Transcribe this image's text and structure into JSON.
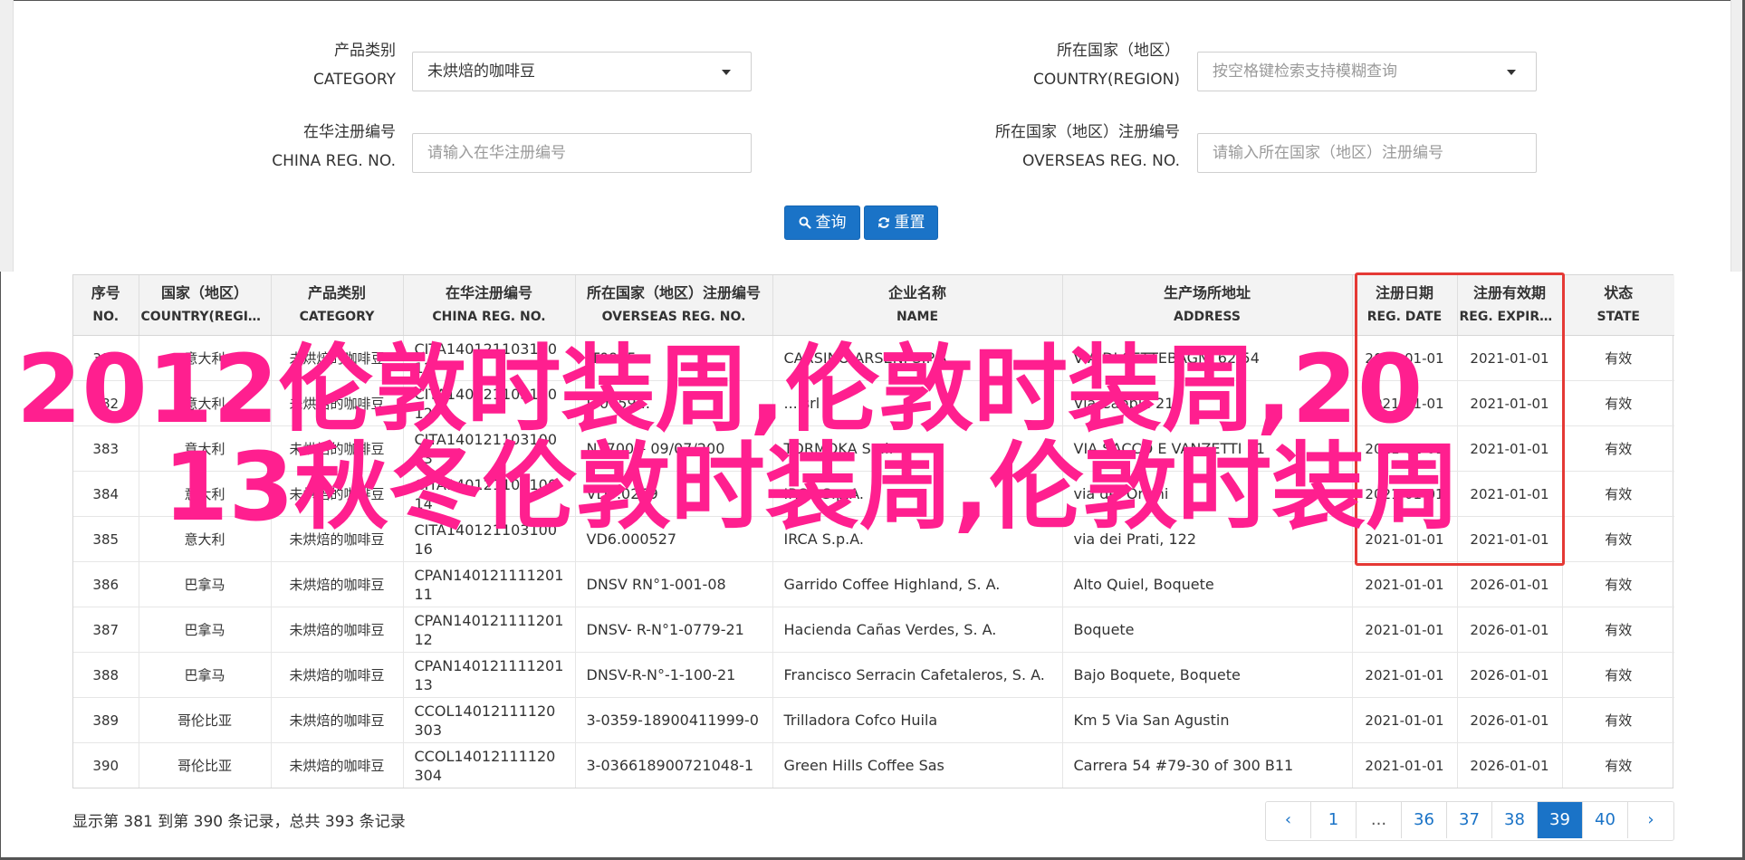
{
  "filters": {
    "category": {
      "label_cn": "产品类别",
      "label_en": "CATEGORY",
      "value": "未烘焙的咖啡豆"
    },
    "country": {
      "label_cn": "所在国家（地区）",
      "label_en": "COUNTRY(REGION)",
      "placeholder": "按空格键检索支持模糊查询"
    },
    "china_reg": {
      "label_cn": "在华注册编号",
      "label_en": "CHINA REG. NO.",
      "placeholder": "请输入在华注册编号"
    },
    "overseas_reg": {
      "label_cn": "所在国家（地区）注册编号",
      "label_en": "OVERSEAS REG. NO.",
      "placeholder": "请输入所在国家（地区）注册编号"
    }
  },
  "buttons": {
    "query": "查询",
    "reset": "重置"
  },
  "table": {
    "headers": [
      {
        "cn": "序号",
        "en": "NO."
      },
      {
        "cn": "国家（地区）",
        "en": "COUNTRY(REGIO..."
      },
      {
        "cn": "产品类别",
        "en": "CATEGORY"
      },
      {
        "cn": "在华注册编号",
        "en": "CHINA REG. NO."
      },
      {
        "cn": "所在国家（地区）注册编号",
        "en": "OVERSEAS REG. NO."
      },
      {
        "cn": "企业名称",
        "en": "NAME"
      },
      {
        "cn": "生产场所地址",
        "en": "ADDRESS"
      },
      {
        "cn": "注册日期",
        "en": "REG. DATE"
      },
      {
        "cn": "注册有效期",
        "en": "REG. EXPIRE ..."
      },
      {
        "cn": "状态",
        "en": "STATE"
      }
    ],
    "rows": [
      [
        "381",
        "意大利",
        "未烘焙的咖啡豆",
        "CITA14012110310011",
        "IT0905...",
        "CARSINO ARSENI S.P.A.",
        "VIA DI SETTEBAGNI 62/54",
        "2021-01-01",
        "2021-01-01",
        "有效"
      ],
      [
        "382",
        "意大利",
        "未烘焙的咖啡豆",
        "CITA14012110310012",
        "IT0059...",
        "... srl",
        "Via Cabbia 21",
        "2021-01-01",
        "2021-01-01",
        "有效"
      ],
      [
        "383",
        "意大利",
        "未烘焙的咖啡豆",
        "CITA14012110310013",
        "N. 700 – 09/07/200",
        "TORMOKA S.r.l.",
        "VIA SACCO E VANZETTI 11",
        "2021-01-01",
        "2021-01-01",
        "有效"
      ],
      [
        "384",
        "意大利",
        "未烘焙的咖啡豆",
        "CITA14012110310014",
        "VD6.0269",
        "IRCA S.p.A.",
        "via dei Orsini",
        "2021-01-01",
        "2021-01-01",
        "有效"
      ],
      [
        "385",
        "意大利",
        "未烘焙的咖啡豆",
        "CITA14012110310016",
        "VD6.000527",
        "IRCA S.p.A.",
        "via dei Prati, 122",
        "2021-01-01",
        "2021-01-01",
        "有效"
      ],
      [
        "386",
        "巴拿马",
        "未烘焙的咖啡豆",
        "CPAN14012111120111",
        "DNSV RN°1-001-08",
        "Garrido Coffee Highland, S. A.",
        "Alto Quiel, Boquete",
        "2021-01-01",
        "2026-01-01",
        "有效"
      ],
      [
        "387",
        "巴拿马",
        "未烘焙的咖啡豆",
        "CPAN14012111120112",
        "DNSV- R-N°1-0779-21",
        "Hacienda Cañas Verdes, S. A.",
        "Boquete",
        "2021-01-01",
        "2026-01-01",
        "有效"
      ],
      [
        "388",
        "巴拿马",
        "未烘焙的咖啡豆",
        "CPAN14012111120113",
        "DNSV-R-N°-1-100-21",
        "Francisco Serracin Cafetaleros, S. A.",
        "Bajo Boquete, Boquete",
        "2021-01-01",
        "2026-01-01",
        "有效"
      ],
      [
        "389",
        "哥伦比亚",
        "未烘焙的咖啡豆",
        "CCOL14012111120303",
        "3-0359-18900411999-0",
        "Trilladora Cofco Huila",
        "Km 5 Via San Agustin",
        "2021-01-01",
        "2026-01-01",
        "有效"
      ],
      [
        "390",
        "哥伦比亚",
        "未烘焙的咖啡豆",
        "CCOL14012111120304",
        "3-036618900721048-1",
        "Green Hills Coffee Sas",
        "Carrera 54 #79-30 of 300 B11",
        "2021-01-01",
        "2026-01-01",
        "有效"
      ]
    ]
  },
  "summary": "显示第 381 到第 390 条记录，总共 393 条记录",
  "pagination": {
    "prev": "‹",
    "pages": [
      "1",
      "...",
      "36",
      "37",
      "38",
      "39",
      "40"
    ],
    "active": "39",
    "next": "›"
  },
  "overlay": {
    "line1": "2012伦敦时装周,伦敦时装周,20",
    "line2": "13秋冬伦敦时装周,伦敦时装周"
  },
  "colors": {
    "accent": "#1a73c7",
    "highlight_box": "#e53935",
    "overlay_text": "#ff1f8f"
  }
}
